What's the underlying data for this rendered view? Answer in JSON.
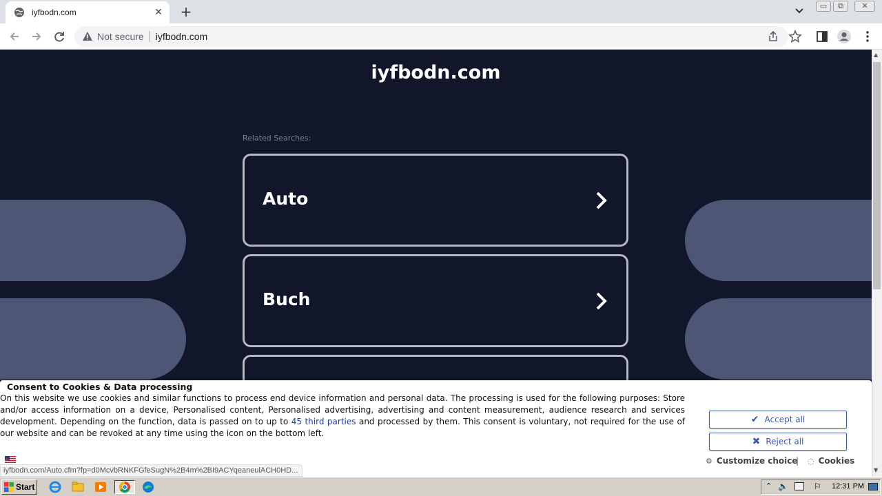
{
  "browser": {
    "tab_title": "iyfbodn.com",
    "tab_close": "✕",
    "new_tab": "+",
    "security_label": "Not secure",
    "url": "iyfbodn.com",
    "window_buttons": {
      "minimize": "▭",
      "restore": "⧉",
      "close": "✕"
    },
    "icons": [
      "globe-icon",
      "back-icon",
      "forward-icon",
      "reload-icon",
      "warning-icon",
      "share-icon",
      "star-icon",
      "sidepanel-icon",
      "profile-icon",
      "menu-icon",
      "tab-search-icon"
    ]
  },
  "page": {
    "site_title": "iyfbodn.com",
    "related_label": "Related Searches:",
    "searches": [
      {
        "label": "Auto"
      },
      {
        "label": "Buch"
      },
      {
        "label": ""
      }
    ],
    "colors": {
      "background": "#12162b",
      "pill": "#4d5675",
      "card_border": "#b7b9c2"
    }
  },
  "consent": {
    "title": "Consent to Cookies & Data processing",
    "text_before_link": "On this website we use cookies and similar functions to process end device information and personal data. The processing is used for the following purposes: Store and/or access information on a device, Personalised content, Personalised advertising, advertising and content measurement, audience research and services development. Depending on the function, data is passed on to up to ",
    "link_text": "45 third parties",
    "text_after_link": " and processed by them. This consent is voluntary, not required for the use of our website and can be revoked at any time using the icon on the bottom left.",
    "accept_label": "Accept all",
    "reject_label": "Reject all",
    "customize_label": "Customize choice",
    "separator": "|",
    "cookies_label": "Cookies",
    "accent_color": "#3c5aa6"
  },
  "status_bar": {
    "url": "iyfbodn.com/Auto.cfm?fp=d0McvbRNKFGfeSugN%2B4m%2BI9ACYqeaneulACH0HD..."
  },
  "taskbar": {
    "start_label": "Start",
    "apps": [
      "ie-icon",
      "explorer-icon",
      "media-player-icon",
      "chrome-icon",
      "edge-icon"
    ],
    "clock": "12:31 PM"
  }
}
